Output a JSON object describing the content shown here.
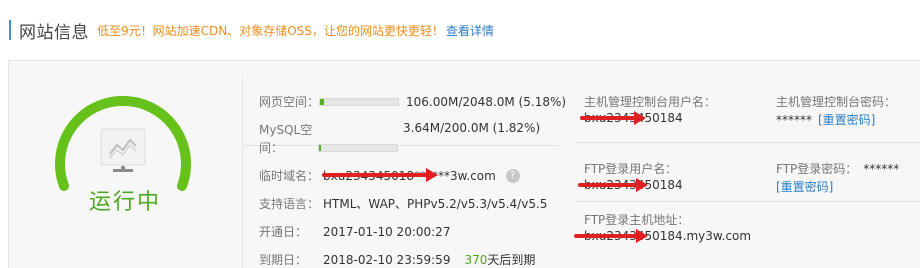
{
  "header": {
    "title": "网站信息",
    "promo": "低至9元！网站加速CDN、对象存储OSS，让您的网站更快更轻！",
    "details_link": "查看详情"
  },
  "status": {
    "label": "运行中",
    "color": "#55b028"
  },
  "info": {
    "web_space_label": "网页空间：",
    "web_space_value": "106.00M/2048.0M (5.18%)",
    "web_space_fraction": 0.0518,
    "mysql_label_1": "MySQL空",
    "mysql_label_2": "间：",
    "mysql_value": "3.64M/200.0M (1.82%)",
    "mysql_fraction": 0.0182,
    "temp_domain_label": "临时域名：",
    "temp_domain_value": "bxu234345018******3w.com",
    "help_icon": "?",
    "languages_label": "支持语言：",
    "languages_value": "HTML、WAP、PHPv5.2/v5.3/v5.4/v5.5",
    "open_date_label": "开通日：",
    "open_date_value": "2017-01-10 20:00:27",
    "expire_label": "到期日：",
    "expire_value": "2018-02-10 23:59:59",
    "days_left_num": "370",
    "days_left_suffix": "天后到期"
  },
  "accounts": {
    "host_user_label": "主机管理控制台用户名：",
    "host_user_value": "bxu2343450184",
    "host_pwd_label": "主机管理控制台密码：",
    "host_pwd_value": "******",
    "host_reset": "[重置密码]",
    "ftp_user_label": "FTP登录用户名：",
    "ftp_user_value": "bxu2343450184",
    "ftp_pwd_label": "FTP登录密码：",
    "ftp_pwd_value": "******",
    "ftp_reset": "[重置密码]",
    "ftp_host_label": "FTP登录主机地址：",
    "ftp_host_value": "bxu2343450184.my3w.com"
  }
}
